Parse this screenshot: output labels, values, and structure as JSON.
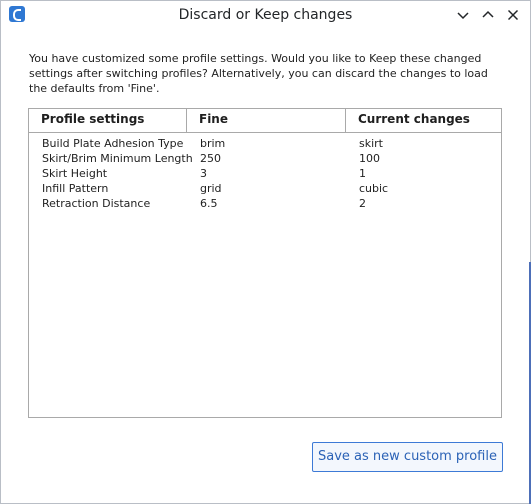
{
  "window": {
    "title": "Discard or Keep changes",
    "app_icon": "cura-icon"
  },
  "titlebar_buttons": [
    "chevron-down-icon",
    "chevron-up-icon",
    "close-icon"
  ],
  "message": "You have customized some profile settings. Would you like to Keep these changed settings after switching profiles? Alternatively, you can discard the changes to load the defaults from 'Fine'.",
  "table": {
    "headers": [
      "Profile settings",
      "Fine",
      "Current changes"
    ],
    "rows": [
      {
        "setting": "Build Plate Adhesion Type",
        "fine": "brim",
        "current": "skirt"
      },
      {
        "setting": "Skirt/Brim Minimum Length",
        "fine": "250",
        "current": "100"
      },
      {
        "setting": "Skirt Height",
        "fine": "3",
        "current": "1"
      },
      {
        "setting": "Infill Pattern",
        "fine": "grid",
        "current": "cubic"
      },
      {
        "setting": "Retraction Distance",
        "fine": "6.5",
        "current": "2"
      }
    ]
  },
  "buttons": {
    "save_custom": "Save as new custom profile"
  },
  "colors": {
    "accent": "#2f78d3",
    "button_border": "#3d7ad6",
    "button_text": "#2b62b6"
  }
}
